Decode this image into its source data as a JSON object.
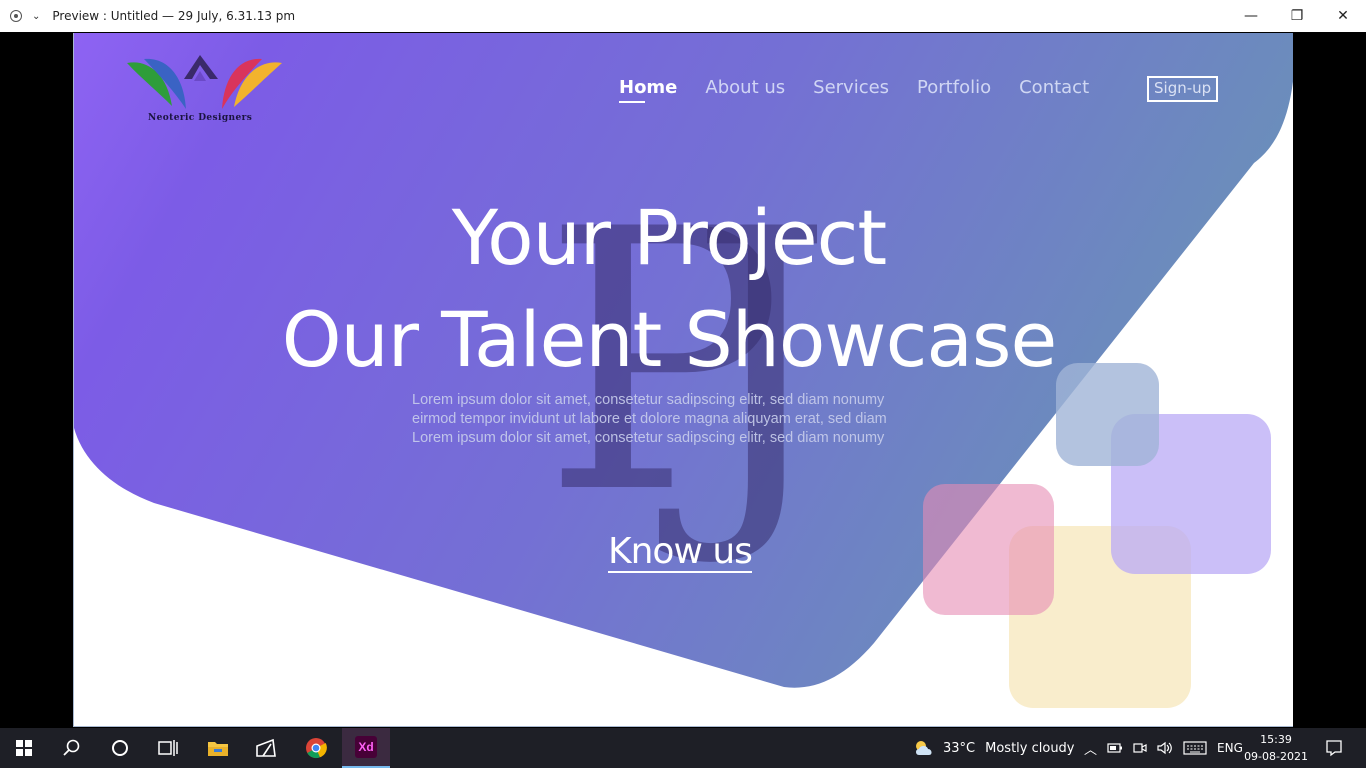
{
  "window": {
    "title": "Preview : Untitled — 29 July, 6.31.13 pm",
    "controls": {
      "minimize": "—",
      "restore": "❐",
      "close": "✕"
    }
  },
  "site": {
    "logo_text": "Neoteric Designers",
    "nav": [
      {
        "label": "Home",
        "active": true
      },
      {
        "label": "About us",
        "active": false
      },
      {
        "label": "Services",
        "active": false
      },
      {
        "label": "Portfolio",
        "active": false
      },
      {
        "label": "Contact",
        "active": false
      }
    ],
    "signup_label": "Sign-up",
    "watermark": "PJ",
    "headline_1": "Your Project",
    "headline_2": "Our Talent Showcase",
    "lorem": [
      "Lorem ipsum dolor sit amet, consetetur sadipscing elitr, sed diam nonumy",
      "eirmod tempor invidunt ut labore et dolore magna aliquyam erat, sed diam",
      "Lorem ipsum dolor sit amet, consetetur sadipscing elitr, sed diam nonumy"
    ],
    "cta_label": "Know us",
    "colors": {
      "gradient_start": "#8a5cf0",
      "gradient_mid": "#7a5fe0",
      "gradient_end": "#6b8cb8"
    }
  },
  "taskbar": {
    "apps": [
      "windows-start",
      "search",
      "cortana",
      "task-view",
      "file-explorer",
      "tablet-app",
      "chrome",
      "adobe-xd"
    ],
    "xd_label": "Xd",
    "weather": {
      "temp": "33°C",
      "condition": "Mostly cloudy"
    },
    "language": "ENG",
    "time": "15:39",
    "date": "09-08-2021"
  }
}
